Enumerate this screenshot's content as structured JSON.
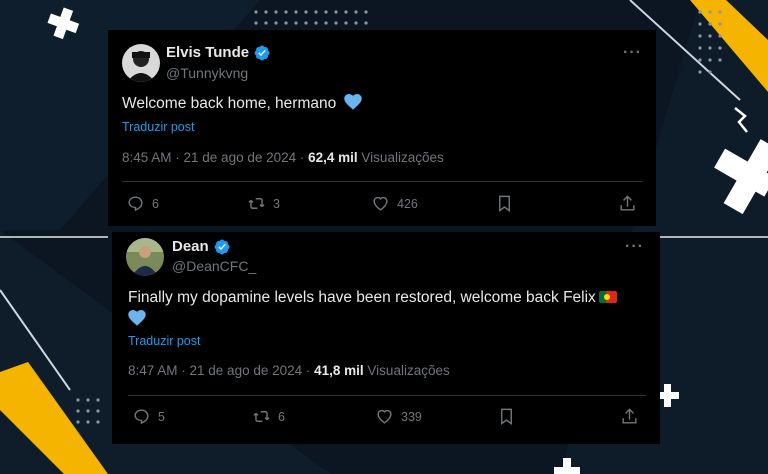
{
  "posts": [
    {
      "name": "Elvis Tunde",
      "handle": "@Tunnykvng",
      "text": "Welcome back home, hermano",
      "translate": "Traduzir post",
      "time": "8:45 AM · 21 de ago de 2024 · ",
      "views": "62,4 mil",
      "views_label": " Visualizações",
      "replies": "6",
      "reposts": "3",
      "likes": "426",
      "emoji": "blue-heart"
    },
    {
      "name": "Dean",
      "handle": "@DeanCFC_",
      "text": "Finally my dopamine levels have been restored, welcome back Felix",
      "translate": "Traduzir post",
      "time": "8:47 AM · 21 de ago de 2024 · ",
      "views": "41,8 mil",
      "views_label": " Visualizações",
      "replies": "5",
      "reposts": "6",
      "likes": "339",
      "emoji": "portugal-flag, blue-heart"
    }
  ],
  "colors": {
    "accent_blue": "#1d9bf0",
    "background": "#0b1622",
    "stripe_yellow": "#f5b400",
    "heart_blue": "#6cb4ee"
  },
  "icons": {
    "more": "···",
    "verified": "verified-badge-icon",
    "reply": "reply-icon",
    "repost": "repost-icon",
    "like": "heart-icon",
    "bookmark": "bookmark-icon",
    "share": "share-icon"
  }
}
